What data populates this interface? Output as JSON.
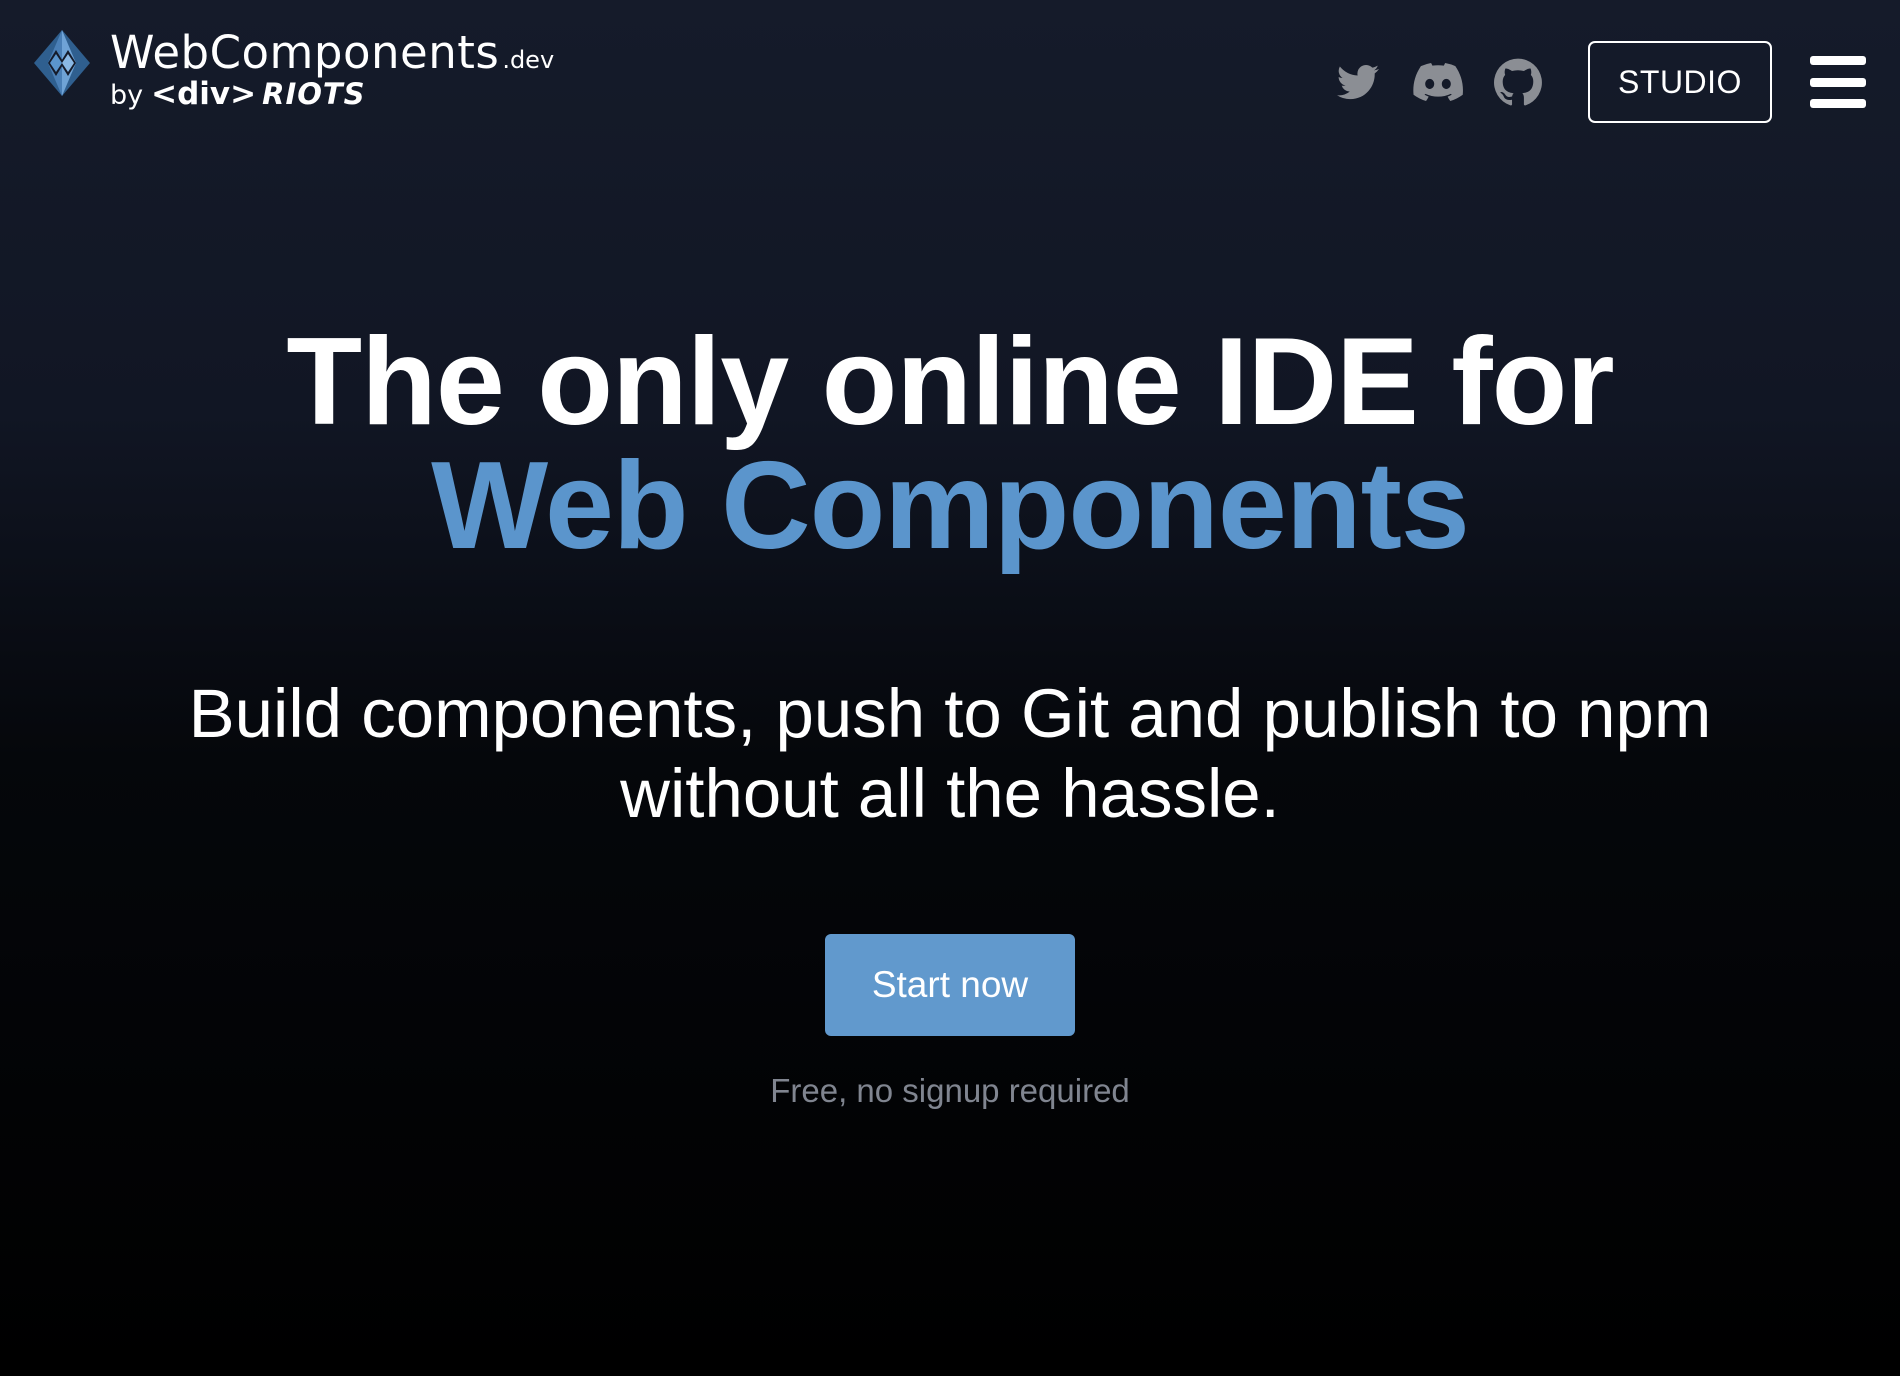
{
  "header": {
    "brand": {
      "name": "WebComponents",
      "tld": ".dev",
      "by": "by",
      "div": "<div>",
      "riots": "RIOTS",
      "logo_icon": "webcomponents-diamond-logo"
    },
    "social": [
      {
        "name": "twitter",
        "icon": "twitter-icon"
      },
      {
        "name": "discord",
        "icon": "discord-icon"
      },
      {
        "name": "github",
        "icon": "github-icon"
      }
    ],
    "studio_label": "STUDIO",
    "menu_icon": "hamburger-menu-icon"
  },
  "hero": {
    "title_line1": "The only online IDE for",
    "title_line2": "Web Components",
    "subtitle": "Build components, push to Git and publish to npm without all the hassle.",
    "cta_label": "Start now",
    "cta_note": "Free, no signup required"
  },
  "colors": {
    "accent": "#5b95cc",
    "button": "#6199cd",
    "muted_text": "#808590",
    "icon_gray": "#8b8e94",
    "background_top": "#151b2a",
    "background_bottom": "#000000"
  }
}
